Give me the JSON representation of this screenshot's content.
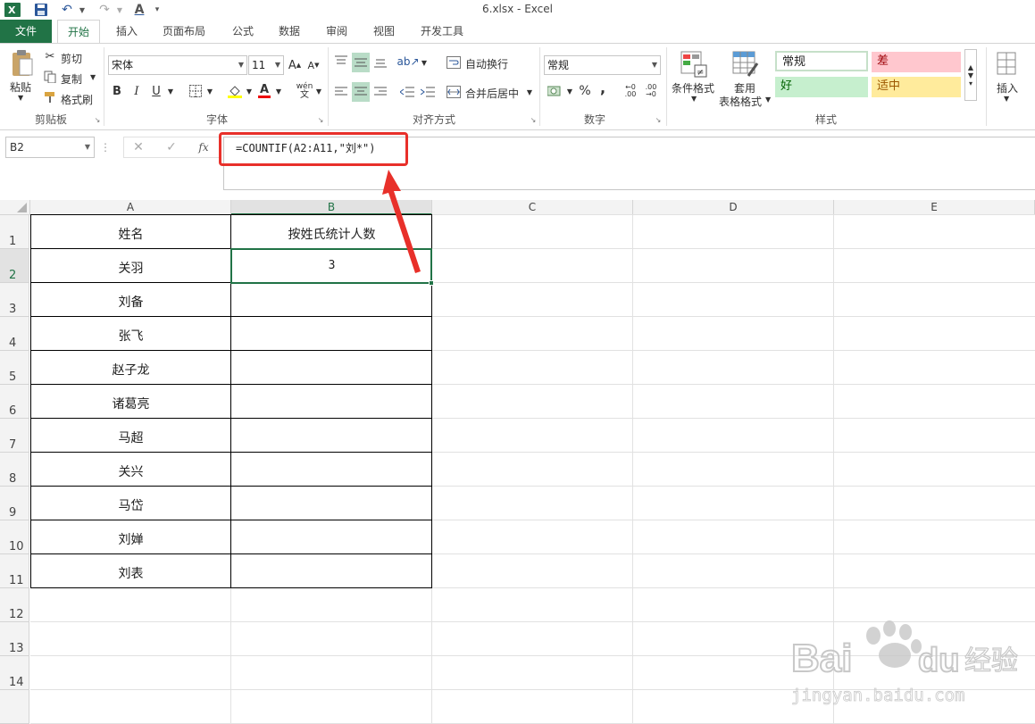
{
  "window": {
    "title": "6.xlsx - Excel"
  },
  "qat": {
    "excel_logo": "X",
    "save": "💾",
    "undo": "↶",
    "redo": "↷",
    "font_color": "A"
  },
  "tabs": [
    "文件",
    "开始",
    "插入",
    "页面布局",
    "公式",
    "数据",
    "审阅",
    "视图",
    "开发工具"
  ],
  "active_tab": "开始",
  "ribbon": {
    "clipboard": {
      "paste": "粘贴",
      "cut": "剪切",
      "copy": "复制",
      "format_painter": "格式刷",
      "label": "剪贴板"
    },
    "font": {
      "name": "宋体",
      "size": "11",
      "grow": "A",
      "shrink": "A",
      "bold": "B",
      "italic": "I",
      "underline": "U",
      "font_color_letter": "A",
      "phonetic": "wén",
      "label": "字体"
    },
    "alignment": {
      "wrap": "自动换行",
      "merge": "合并后居中",
      "label": "对齐方式"
    },
    "number": {
      "format": "常规",
      "percent": "%",
      "comma": ",",
      "label": "数字"
    },
    "styles": {
      "conditional": "条件格式",
      "table1": "套用",
      "table2": "表格格式",
      "normal": "常规",
      "bad": "差",
      "good": "好",
      "neutral": "适中",
      "label": "样式"
    },
    "cells": {
      "insert": "插入"
    }
  },
  "formula_bar": {
    "name_box": "B2",
    "fx": "fx",
    "formula": "=COUNTIF(A2:A11,\"刘*\")"
  },
  "columns": [
    "A",
    "B",
    "C",
    "D",
    "E"
  ],
  "rows": [
    "1",
    "2",
    "3",
    "4",
    "5",
    "6",
    "7",
    "8",
    "9",
    "10",
    "11",
    "12",
    "13",
    "14"
  ],
  "sheet": {
    "A": [
      "姓名",
      "关羽",
      "刘备",
      "张飞",
      "赵子龙",
      "诸葛亮",
      "马超",
      "关兴",
      "马岱",
      "刘婵",
      "刘表"
    ],
    "B1": "按姓氏统计人数",
    "B2": "3"
  },
  "selected_cell": "B2",
  "watermark": {
    "brand": "Bai",
    "brand2": "du",
    "cn": "经验",
    "url": "jingyan.baidu.com"
  }
}
